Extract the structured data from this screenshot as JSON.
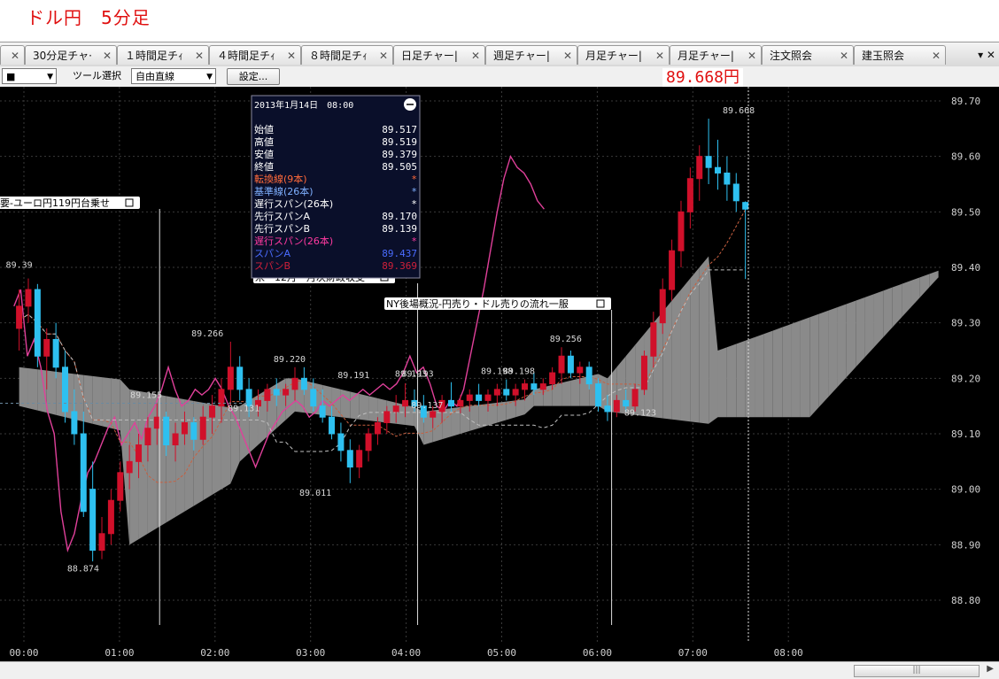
{
  "title": "ドル円　5分足",
  "tabs": [
    {
      "label": "",
      "x": 0,
      "w": 28
    },
    {
      "label": "30分足チャ·",
      "x": 28,
      "w": 104
    },
    {
      "label": "１時間足チｨ",
      "x": 132,
      "w": 104
    },
    {
      "label": "４時間足チｨ",
      "x": 236,
      "w": 104
    },
    {
      "label": "８時間足チｨ",
      "x": 340,
      "w": 104
    },
    {
      "label": "日足チャー|",
      "x": 444,
      "w": 104
    },
    {
      "label": "週足チャー|",
      "x": 548,
      "w": 104
    },
    {
      "label": "月足チャー|",
      "x": 652,
      "w": 104
    },
    {
      "label": "月足チャー|",
      "x": 756,
      "w": 104
    },
    {
      "label": "注文照会",
      "x": 860,
      "w": 104
    },
    {
      "label": "建玉照会",
      "x": 964,
      "w": 104
    }
  ],
  "tab_controls": "▾ ✕",
  "toolbar": {
    "symbol_select": "■",
    "tool_label": "ツール選択",
    "tool_select": "自由直線",
    "settings_button": "設定..."
  },
  "current_price": "89.668円",
  "info_box": {
    "date": "2013年1月14日　08:00",
    "rows": [
      {
        "label": "始値",
        "value": "89.517",
        "color": "#ffffff"
      },
      {
        "label": "高値",
        "value": "89.519",
        "color": "#ffffff"
      },
      {
        "label": "安値",
        "value": "89.379",
        "color": "#ffffff"
      },
      {
        "label": "終値",
        "value": "89.505",
        "color": "#ffffff"
      },
      {
        "label": "転換線(9本)",
        "value": "*",
        "color": "#ff6a3a"
      },
      {
        "label": "基準線(26本)",
        "value": "*",
        "color": "#7fb0ff"
      },
      {
        "label": "遅行スパン(26本)",
        "value": "*",
        "color": "#ffffff"
      },
      {
        "label": "先行スパンA",
        "value": "89.170",
        "color": "#ffffff"
      },
      {
        "label": "先行スパンB",
        "value": "89.139",
        "color": "#ffffff"
      },
      {
        "label": "遅行スパン(26本)",
        "value": "*",
        "color": "#ff3aa0"
      },
      {
        "label": "スパンA",
        "value": "89.437",
        "color": "#4a6cff"
      },
      {
        "label": "スパンB",
        "value": "89.369",
        "color": "#d0203a"
      }
    ]
  },
  "news": [
    {
      "text": "要-ユーロ円119円台乗せ",
      "line_time": 1.42
    },
    {
      "text": "米・12月　月次財政収支",
      "line_time": 4.12
    },
    {
      "text": "NY後場概況-円売り・ドル売りの流れ一服",
      "line_time": 6.15
    }
  ],
  "chart_data": {
    "type": "candlestick",
    "title": "ドル円　5分足",
    "y_axis": {
      "ticks": [
        88.8,
        88.9,
        89.0,
        89.1,
        89.2,
        89.3,
        89.4,
        89.5,
        89.6,
        89.7
      ],
      "tick_labels": [
        "88.80",
        "88.90",
        "89.00",
        "89.10",
        "89.20",
        "89.30",
        "89.40",
        "89.50",
        "89.60",
        "89.70"
      ],
      "ylim": [
        88.71,
        89.72
      ]
    },
    "x_axis": {
      "ticks": [
        0,
        1,
        2,
        3,
        4,
        5,
        6,
        7,
        8
      ],
      "tick_labels": [
        "00:00",
        "01:00",
        "02:00",
        "03:00",
        "04:00",
        "05:00",
        "06:00",
        "07:00",
        "08:00"
      ]
    },
    "colors": {
      "up": "#d0102a",
      "down": "#2ec0f0",
      "cloud_bull": "#8a8a8a",
      "cloud_bear": "#1a2d7a",
      "chikou": "#e0409a",
      "tenkan": "#c86040",
      "kijun": "#c0c0c0"
    },
    "annotations": [
      {
        "t": -0.05,
        "price": 89.39,
        "label": "89.39"
      },
      {
        "t": 1.28,
        "price": 89.155,
        "label": "89.155"
      },
      {
        "t": 1.92,
        "price": 89.266,
        "label": "89.266"
      },
      {
        "t": 2.3,
        "price": 89.131,
        "label": "89.131"
      },
      {
        "t": 2.78,
        "price": 89.22,
        "label": "89.220"
      },
      {
        "t": 3.45,
        "price": 89.191,
        "label": "89.191"
      },
      {
        "t": 4.12,
        "price": 89.193,
        "label": "89.193"
      },
      {
        "t": 4.05,
        "price": 89.193,
        "label": "89.193"
      },
      {
        "t": 4.22,
        "price": 89.137,
        "label": "89.137"
      },
      {
        "t": 4.95,
        "price": 89.198,
        "label": "89.198"
      },
      {
        "t": 5.18,
        "price": 89.198,
        "label": "89.198"
      },
      {
        "t": 5.67,
        "price": 89.256,
        "label": "89.256"
      },
      {
        "t": 6.45,
        "price": 89.123,
        "label": "89.123"
      },
      {
        "t": 7.48,
        "price": 89.668,
        "label": "89.668"
      },
      {
        "t": 3.05,
        "price": 89.011,
        "label": "89.011"
      },
      {
        "t": 0.62,
        "price": 88.874,
        "label": "88.874"
      }
    ],
    "candles": [
      [
        89.29,
        89.36,
        89.25,
        89.33
      ],
      [
        89.33,
        89.38,
        89.3,
        89.36
      ],
      [
        89.36,
        89.37,
        89.22,
        89.24
      ],
      [
        89.24,
        89.29,
        89.18,
        89.27
      ],
      [
        89.27,
        89.3,
        89.2,
        89.22
      ],
      [
        89.22,
        89.25,
        89.12,
        89.14
      ],
      [
        89.14,
        89.18,
        89.08,
        89.1
      ],
      [
        89.1,
        89.14,
        88.95,
        88.96
      ],
      [
        89.0,
        89.05,
        88.87,
        88.89
      ],
      [
        88.89,
        88.95,
        88.874,
        88.92
      ],
      [
        88.92,
        89.0,
        88.9,
        88.98
      ],
      [
        88.98,
        89.05,
        88.96,
        89.03
      ],
      [
        89.03,
        89.08,
        89.0,
        89.05
      ],
      [
        89.05,
        89.1,
        89.02,
        89.08
      ],
      [
        89.08,
        89.13,
        89.05,
        89.11
      ],
      [
        89.11,
        89.155,
        89.08,
        89.13
      ],
      [
        89.13,
        89.14,
        89.06,
        89.08
      ],
      [
        89.08,
        89.12,
        89.05,
        89.1
      ],
      [
        89.1,
        89.14,
        89.08,
        89.12
      ],
      [
        89.12,
        89.13,
        89.07,
        89.09
      ],
      [
        89.09,
        89.15,
        89.08,
        89.13
      ],
      [
        89.13,
        89.17,
        89.1,
        89.15
      ],
      [
        89.15,
        89.2,
        89.12,
        89.18
      ],
      [
        89.18,
        89.266,
        89.15,
        89.22
      ],
      [
        89.22,
        89.24,
        89.16,
        89.18
      ],
      [
        89.18,
        89.2,
        89.13,
        89.15
      ],
      [
        89.15,
        89.18,
        89.131,
        89.16
      ],
      [
        89.16,
        89.19,
        89.14,
        89.18
      ],
      [
        89.18,
        89.2,
        89.15,
        89.17
      ],
      [
        89.17,
        89.19,
        89.15,
        89.18
      ],
      [
        89.18,
        89.22,
        89.16,
        89.2
      ],
      [
        89.2,
        89.22,
        89.17,
        89.18
      ],
      [
        89.18,
        89.2,
        89.14,
        89.15
      ],
      [
        89.15,
        89.18,
        89.12,
        89.13
      ],
      [
        89.13,
        89.15,
        89.09,
        89.1
      ],
      [
        89.1,
        89.12,
        89.05,
        89.07
      ],
      [
        89.07,
        89.09,
        89.011,
        89.04
      ],
      [
        89.04,
        89.08,
        89.02,
        89.07
      ],
      [
        89.07,
        89.11,
        89.05,
        89.1
      ],
      [
        89.1,
        89.13,
        89.08,
        89.12
      ],
      [
        89.12,
        89.15,
        89.1,
        89.14
      ],
      [
        89.14,
        89.17,
        89.12,
        89.15
      ],
      [
        89.15,
        89.191,
        89.13,
        89.16
      ],
      [
        89.16,
        89.18,
        89.14,
        89.15
      ],
      [
        89.15,
        89.17,
        89.12,
        89.13
      ],
      [
        89.13,
        89.15,
        89.11,
        89.14
      ],
      [
        89.14,
        89.17,
        89.12,
        89.16
      ],
      [
        89.16,
        89.193,
        89.14,
        89.15
      ],
      [
        89.15,
        89.17,
        89.137,
        89.16
      ],
      [
        89.16,
        89.18,
        89.14,
        89.17
      ],
      [
        89.17,
        89.19,
        89.15,
        89.16
      ],
      [
        89.16,
        89.18,
        89.14,
        89.17
      ],
      [
        89.17,
        89.19,
        89.15,
        89.18
      ],
      [
        89.18,
        89.198,
        89.16,
        89.17
      ],
      [
        89.17,
        89.19,
        89.15,
        89.18
      ],
      [
        89.18,
        89.198,
        89.16,
        89.19
      ],
      [
        89.19,
        89.21,
        89.17,
        89.18
      ],
      [
        89.18,
        89.2,
        89.17,
        89.19
      ],
      [
        89.19,
        89.22,
        89.18,
        89.21
      ],
      [
        89.21,
        89.256,
        89.19,
        89.24
      ],
      [
        89.24,
        89.25,
        89.2,
        89.21
      ],
      [
        89.21,
        89.23,
        89.19,
        89.22
      ],
      [
        89.22,
        89.23,
        89.18,
        89.19
      ],
      [
        89.19,
        89.2,
        89.14,
        89.15
      ],
      [
        89.15,
        89.17,
        89.123,
        89.14
      ],
      [
        89.14,
        89.17,
        89.13,
        89.16
      ],
      [
        89.16,
        89.18,
        89.14,
        89.15
      ],
      [
        89.15,
        89.19,
        89.14,
        89.18
      ],
      [
        89.18,
        89.25,
        89.17,
        89.24
      ],
      [
        89.24,
        89.32,
        89.22,
        89.3
      ],
      [
        89.3,
        89.38,
        89.28,
        89.36
      ],
      [
        89.36,
        89.45,
        89.34,
        89.43
      ],
      [
        89.43,
        89.52,
        89.4,
        89.5
      ],
      [
        89.5,
        89.58,
        89.47,
        89.56
      ],
      [
        89.56,
        89.62,
        89.52,
        89.6
      ],
      [
        89.6,
        89.668,
        89.55,
        89.58
      ],
      [
        89.58,
        89.63,
        89.54,
        89.57
      ],
      [
        89.57,
        89.6,
        89.52,
        89.55
      ],
      [
        89.55,
        89.57,
        89.5,
        89.52
      ],
      [
        89.517,
        89.519,
        89.379,
        89.505
      ]
    ]
  }
}
